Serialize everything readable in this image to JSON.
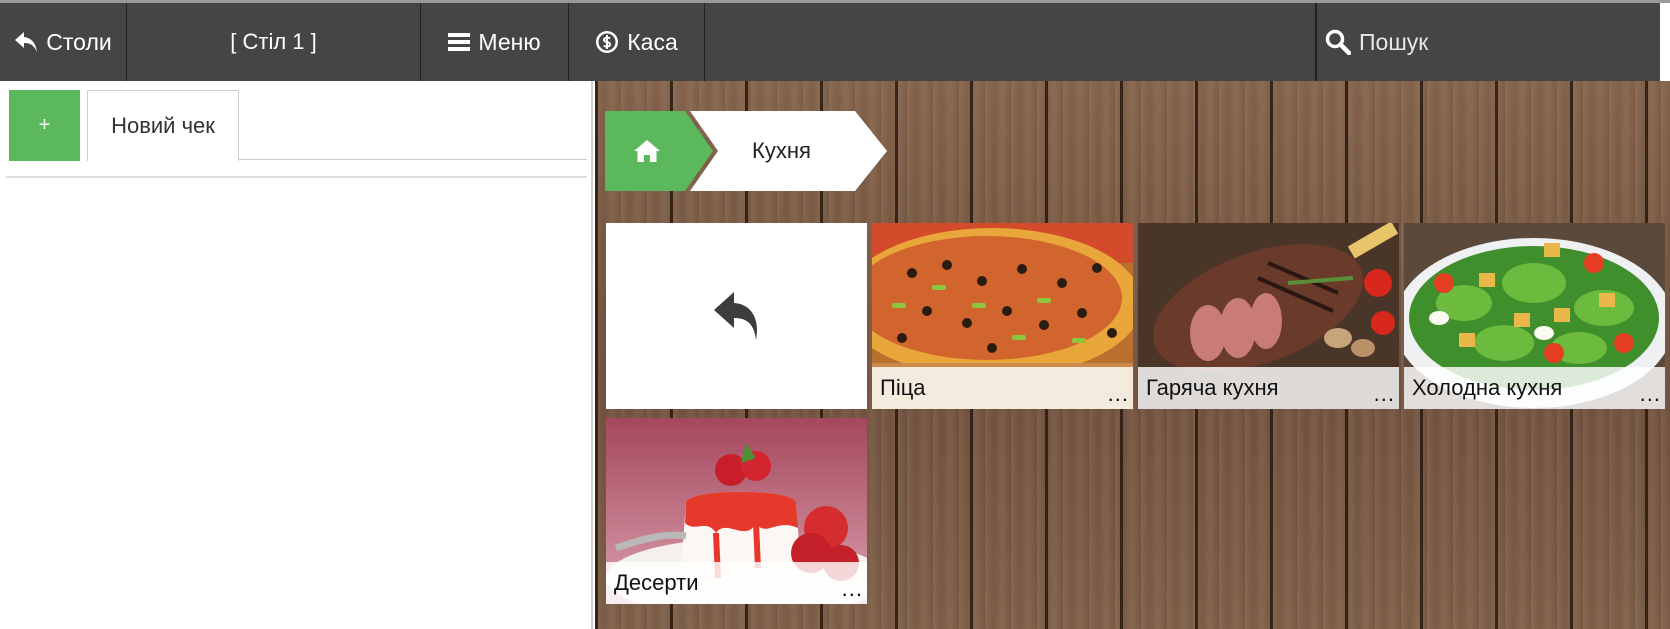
{
  "topbar": {
    "tables_label": "Столи",
    "table_name": "[ Стіл 1 ]",
    "menu_label": "Меню",
    "cash_label": "Каса",
    "search_placeholder": "Пошук"
  },
  "order_panel": {
    "add_button_label": "+",
    "check_tab_label": "Новий чек"
  },
  "breadcrumb": {
    "home_icon": "home-icon",
    "current_label": "Кухня"
  },
  "categories": [
    {
      "label": "Піца",
      "more": "...",
      "image": "pizza"
    },
    {
      "label": "Гаряча кухня",
      "more": "...",
      "image": "grilled-steak"
    },
    {
      "label": "Холодна кухня",
      "more": "...",
      "image": "salad"
    },
    {
      "label": "Десерти",
      "more": "...",
      "image": "panna-cotta"
    }
  ],
  "colors": {
    "topbar_bg": "#454545",
    "accent_green": "#5cb85c",
    "wood": "#7a5a44"
  }
}
